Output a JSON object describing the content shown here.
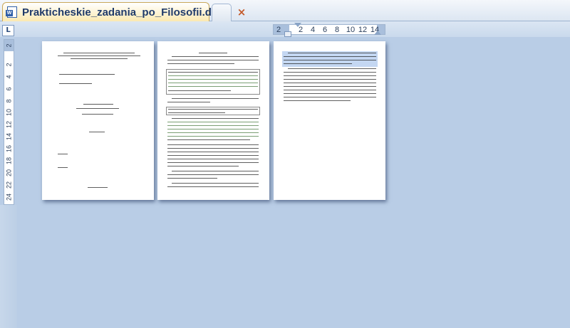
{
  "tab": {
    "title": "Prakticheskie_zadania_po_Filosofii.docx",
    "close_icon": "×",
    "app_icon": "word-document-icon"
  },
  "ruler": {
    "tab_selector": "L",
    "h_ticks": [
      "2",
      "2",
      "4",
      "6",
      "8",
      "10",
      "12",
      "14"
    ],
    "v_ticks": [
      "2",
      "2",
      "4",
      "6",
      "8",
      "10",
      "12",
      "14",
      "16",
      "18",
      "20",
      "22",
      "24"
    ]
  },
  "pages": [
    {
      "name": "title-page"
    },
    {
      "name": "tasks-page"
    },
    {
      "name": "selected-text-page"
    }
  ],
  "colors": {
    "workspace": "#b9cde6",
    "tab_active": "#fbe9b0",
    "selection": "#c4d7f2"
  }
}
